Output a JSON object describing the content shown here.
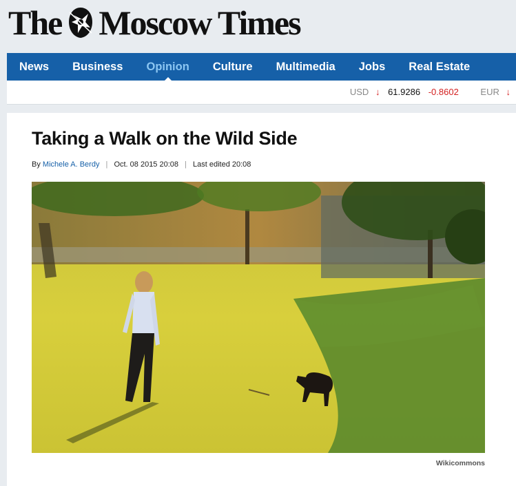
{
  "site": {
    "logo_left": "The",
    "logo_right": "Moscow Times"
  },
  "nav": {
    "items": [
      {
        "label": "News"
      },
      {
        "label": "Business"
      },
      {
        "label": "Opinion",
        "active": true
      },
      {
        "label": "Culture"
      },
      {
        "label": "Multimedia"
      },
      {
        "label": "Jobs"
      },
      {
        "label": "Real Estate"
      }
    ]
  },
  "ticker": {
    "usd": {
      "code": "USD",
      "arrow": "↓",
      "value": "61.9286",
      "change": "-0.8602"
    },
    "eur": {
      "code": "EUR",
      "arrow": "↓"
    }
  },
  "article": {
    "headline": "Taking a Walk on the Wild Side",
    "byline_prefix": "By",
    "author": "Michele A. Berdy",
    "separator": "|",
    "date": "Oct. 08 2015 20:08",
    "last_edited": "Last edited 20:08",
    "photo_credit": "Wikicommons"
  },
  "colors": {
    "nav_bg": "#1660a8",
    "nav_active": "#8cc6f2",
    "ticker_down": "#d42020"
  }
}
